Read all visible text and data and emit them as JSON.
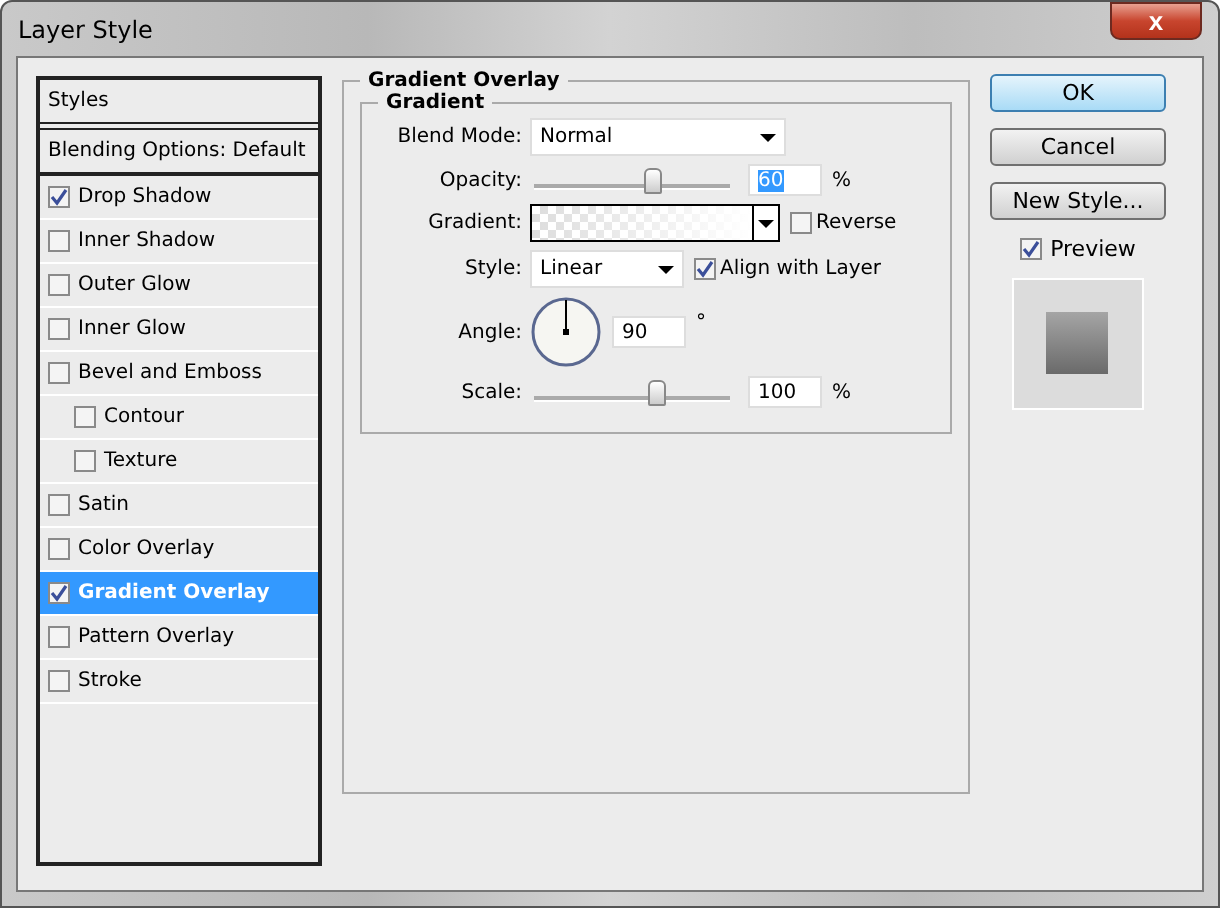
{
  "window": {
    "title": "Layer Style",
    "close": "x"
  },
  "styles_list": [
    {
      "kind": "header",
      "label": "Styles"
    },
    {
      "kind": "plain",
      "label": "Blending Options: Default",
      "selected": false
    },
    {
      "kind": "check",
      "label": "Drop Shadow",
      "checked": true,
      "selected": false
    },
    {
      "kind": "check",
      "label": "Inner Shadow",
      "checked": false,
      "selected": false
    },
    {
      "kind": "check",
      "label": "Outer Glow",
      "checked": false,
      "selected": false
    },
    {
      "kind": "check",
      "label": "Inner Glow",
      "checked": false,
      "selected": false
    },
    {
      "kind": "check",
      "label": "Bevel and Emboss",
      "checked": false,
      "selected": false,
      "children": [
        {
          "kind": "check",
          "label": "Contour",
          "checked": false,
          "selected": false
        },
        {
          "kind": "check",
          "label": "Texture",
          "checked": false,
          "selected": false
        }
      ]
    },
    {
      "kind": "check",
      "label": "Satin",
      "checked": false,
      "selected": false
    },
    {
      "kind": "check",
      "label": "Color Overlay",
      "checked": false,
      "selected": false
    },
    {
      "kind": "check",
      "label": "Gradient Overlay",
      "checked": true,
      "selected": true
    },
    {
      "kind": "check",
      "label": "Pattern Overlay",
      "checked": false,
      "selected": false
    },
    {
      "kind": "check",
      "label": "Stroke",
      "checked": false,
      "selected": false
    }
  ],
  "panel": {
    "title": "Gradient Overlay",
    "group": "Gradient",
    "blend_mode": {
      "label": "Blend Mode:",
      "value": "Normal"
    },
    "opacity": {
      "label": "Opacity:",
      "level": 0.6,
      "value": "60",
      "unit": "%"
    },
    "gradient": {
      "label": "Gradient:",
      "reverse": {
        "label": "Reverse",
        "checked": false
      }
    },
    "style": {
      "label": "Style:",
      "value": "Linear",
      "align": {
        "label": "Align with Layer",
        "checked": true
      }
    },
    "angle": {
      "label": "Angle:",
      "value": "90",
      "unit": "°"
    },
    "scale": {
      "label": "Scale:",
      "level": 0.62,
      "value": "100",
      "unit": "%"
    }
  },
  "buttons": [
    {
      "label": "OK",
      "default": true
    },
    {
      "label": "Cancel",
      "default": false
    },
    {
      "label": "New Style...",
      "default": false
    }
  ],
  "preview": {
    "label": "Preview",
    "checked": true
  }
}
